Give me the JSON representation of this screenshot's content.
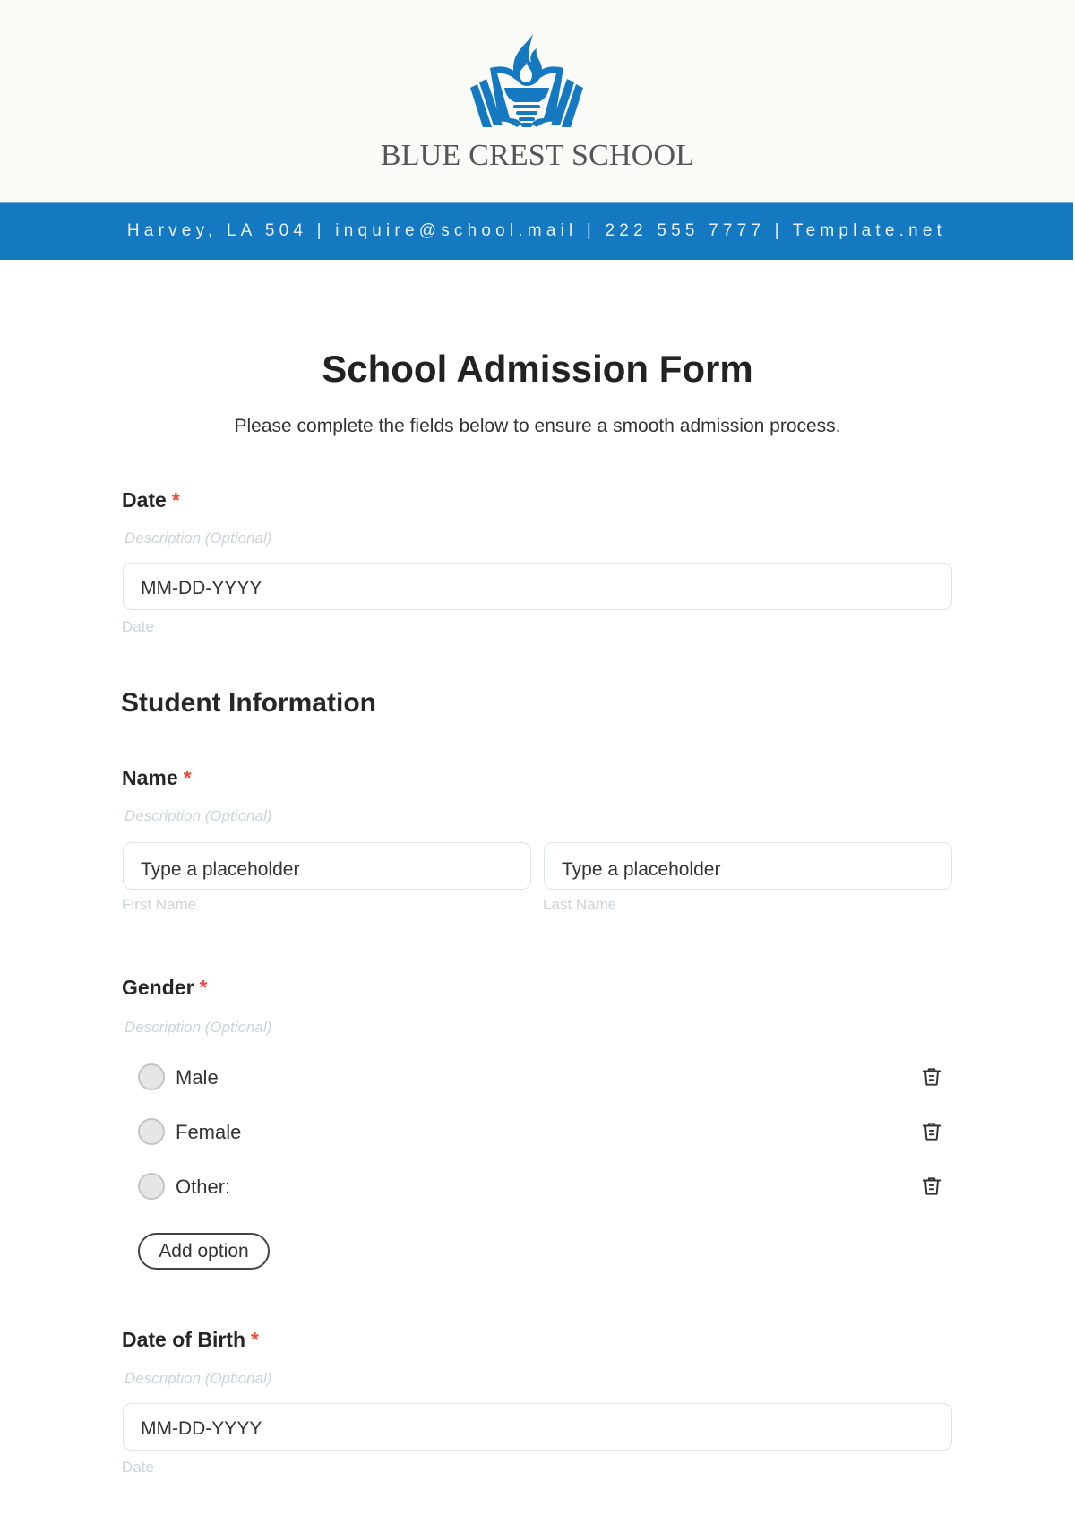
{
  "header": {
    "school_name": "BLUE CREST SCHOOL",
    "logo_icon": "open-book-torch-logo",
    "brand_color": "#1479c1"
  },
  "banner": {
    "contact_line": "Harvey, LA 504 | inquire@school.mail | 222 555 7777 | Template.net"
  },
  "form": {
    "title": "School Admission Form",
    "subtitle": "Please complete the fields below to ensure a smooth admission process.",
    "required_marker": "*",
    "date": {
      "label": "Date",
      "description": "Description (Optional)",
      "placeholder": "MM-DD-YYYY",
      "helper": "Date"
    },
    "section_student": "Student Information",
    "name": {
      "label": "Name",
      "description": "Description (Optional)",
      "first_placeholder": "Type a placeholder",
      "first_helper": "First Name",
      "last_placeholder": "Type a placeholder",
      "last_helper": "Last Name"
    },
    "gender": {
      "label": "Gender",
      "description": "Description (Optional)",
      "options": [
        {
          "label": "Male",
          "delete_icon": "trash-icon"
        },
        {
          "label": "Female",
          "delete_icon": "trash-icon"
        },
        {
          "label": "Other:",
          "delete_icon": "trash-icon"
        }
      ],
      "add_option_label": "Add option"
    },
    "dob": {
      "label": "Date of Birth",
      "description": "Description (Optional)",
      "placeholder": "MM-DD-YYYY",
      "helper": "Date"
    }
  }
}
